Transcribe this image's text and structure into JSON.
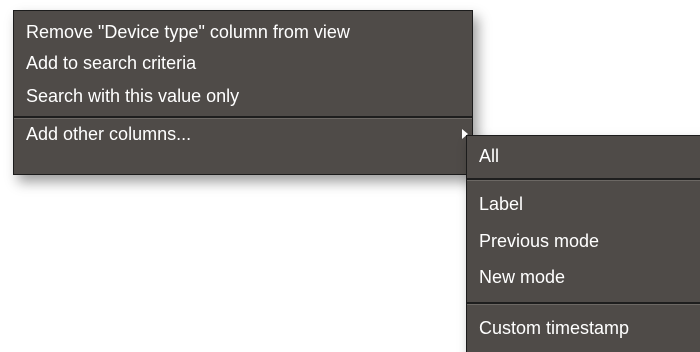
{
  "context_menu": {
    "items": [
      {
        "label": "Remove \"Device type\" column from view"
      },
      {
        "label": "Add to search criteria"
      },
      {
        "label": "Search with this value only"
      },
      {
        "label": "Add other columns...",
        "has_submenu": true
      }
    ],
    "submenu_arrow_icon": "triangle-right-icon"
  },
  "submenu": {
    "items": [
      {
        "label": "All"
      },
      {
        "label": "Label"
      },
      {
        "label": "Previous mode"
      },
      {
        "label": "New mode"
      },
      {
        "label": "Custom timestamp"
      }
    ]
  },
  "colors": {
    "menu_background": "#4f4b48",
    "menu_border": "#1c1c1c",
    "text": "#ffffff"
  }
}
